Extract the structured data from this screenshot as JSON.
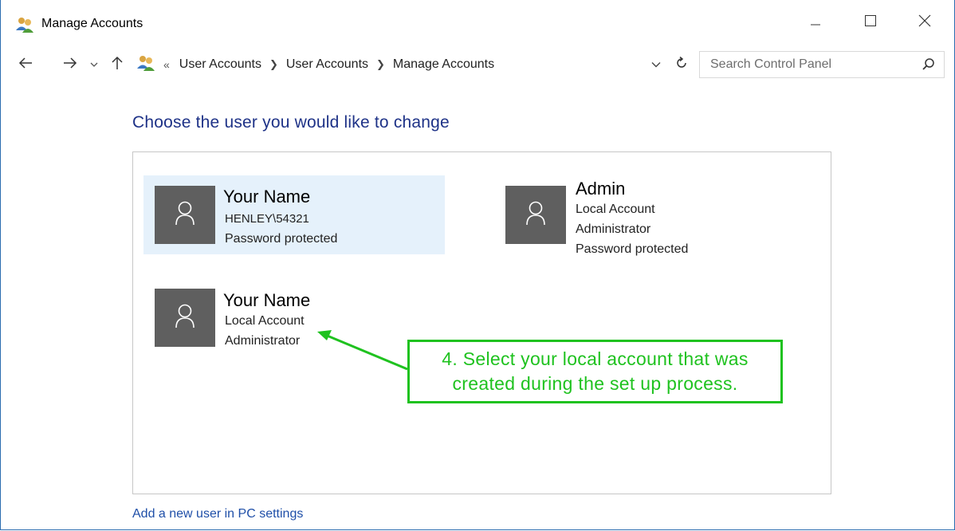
{
  "window": {
    "title": "Manage Accounts",
    "icons": {
      "app": "user-accounts-icon",
      "minimize": "minimize-icon",
      "maximize": "maximize-icon",
      "close": "close-icon"
    }
  },
  "navbar": {
    "overflow": "«",
    "breadcrumbs": [
      "User Accounts",
      "User Accounts",
      "Manage Accounts"
    ],
    "search_placeholder": "Search Control Panel"
  },
  "content": {
    "heading": "Choose the user you would like to change",
    "accounts": [
      {
        "name": "Your Name",
        "lines": [
          "HENLEY\\54321",
          "Password protected"
        ],
        "selected": true
      },
      {
        "name": "Admin",
        "lines": [
          "Local Account",
          "Administrator",
          "Password protected"
        ],
        "selected": false
      },
      {
        "name": "Your Name",
        "lines": [
          "Local Account",
          "Administrator"
        ],
        "selected": false
      }
    ],
    "add_user_link": "Add a new user in PC settings"
  },
  "annotation": {
    "text_line1": "4. Select your local account that was",
    "text_line2": "created during the set up process.",
    "color": "#1fc21f"
  },
  "colors": {
    "heading": "#1e3287",
    "link": "#1f4fa8",
    "avatar": "#5f5f5f",
    "selected": "#e5f1fb"
  }
}
